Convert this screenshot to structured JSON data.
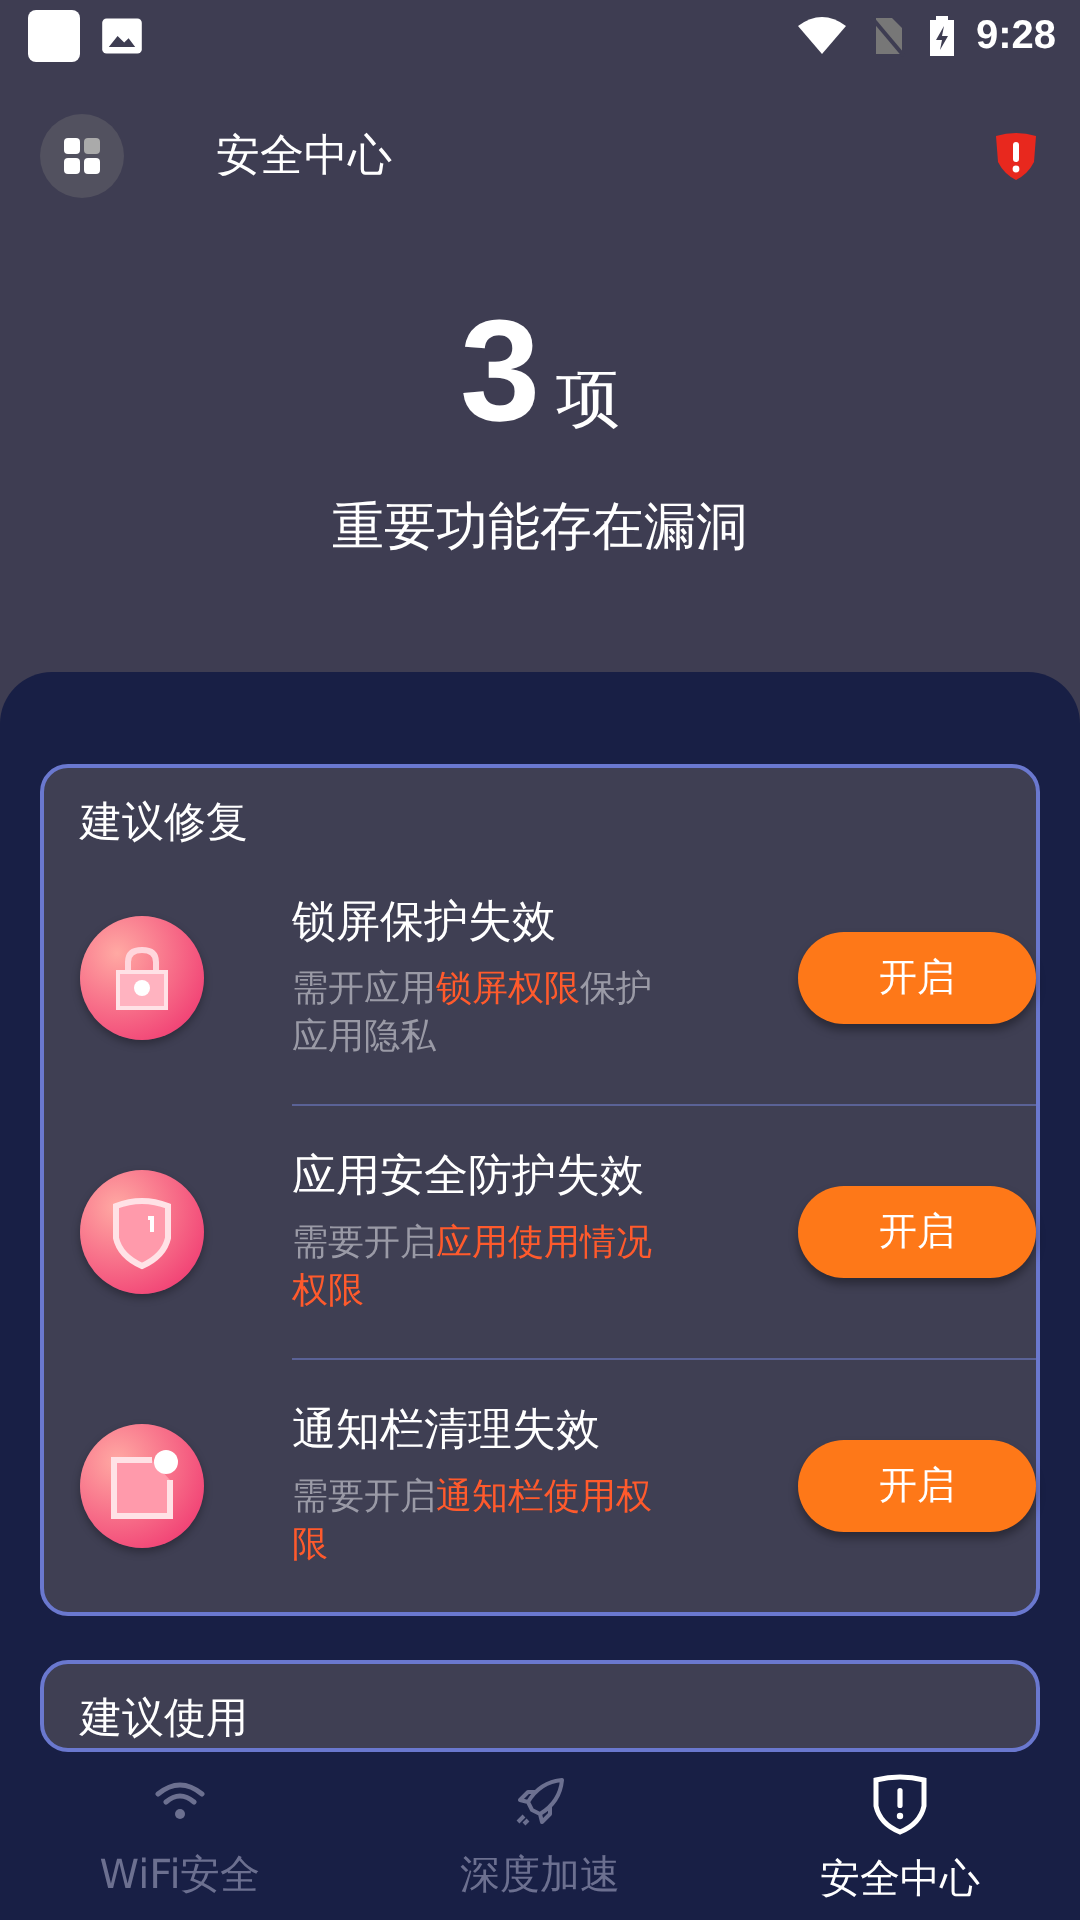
{
  "status_bar": {
    "time": "9:28"
  },
  "header": {
    "title": "安全中心"
  },
  "summary": {
    "count": "3",
    "unit": "项",
    "message": "重要功能存在漏洞"
  },
  "sections": [
    {
      "title": "建议修复",
      "items": [
        {
          "kind": "lock",
          "title": "锁屏保护失效",
          "desc": [
            {
              "text": "需开应用",
              "highlight": false
            },
            {
              "text": "锁屏权限",
              "highlight": true
            },
            {
              "text": "保护应用隐私",
              "highlight": false
            }
          ],
          "button": "开启"
        },
        {
          "kind": "shield",
          "title": "应用安全防护失效",
          "desc": [
            {
              "text": "需要开启",
              "highlight": false
            },
            {
              "text": "应用使用情况权限",
              "highlight": true
            }
          ],
          "button": "开启"
        },
        {
          "kind": "notification",
          "title": "通知栏清理失效",
          "desc": [
            {
              "text": "需要开启",
              "highlight": false
            },
            {
              "text": "通知栏使用权限",
              "highlight": true
            }
          ],
          "button": "开启"
        }
      ]
    },
    {
      "title": "建议使用"
    }
  ],
  "nav": [
    {
      "kind": "wifi",
      "label": "WiFi安全",
      "selected": false
    },
    {
      "kind": "rocket",
      "label": "深度加速",
      "selected": false
    },
    {
      "kind": "shield",
      "label": "安全中心",
      "selected": true
    }
  ]
}
